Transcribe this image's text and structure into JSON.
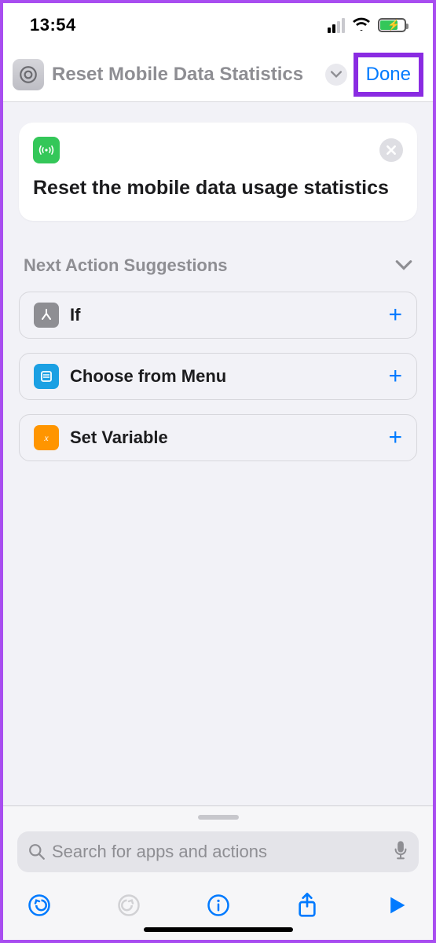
{
  "status": {
    "time": "13:54"
  },
  "nav": {
    "title": "Reset Mobile Data Statistics",
    "done": "Done"
  },
  "action": {
    "text": "Reset the mobile data usage statistics"
  },
  "suggestions": {
    "header": "Next Action Suggestions",
    "items": [
      {
        "label": "If",
        "iconColor": "gray"
      },
      {
        "label": "Choose from Menu",
        "iconColor": "blue"
      },
      {
        "label": "Set Variable",
        "iconColor": "orange"
      }
    ]
  },
  "search": {
    "placeholder": "Search for apps and actions"
  },
  "colors": {
    "link": "#007aff",
    "highlight": "#8a2be2"
  }
}
